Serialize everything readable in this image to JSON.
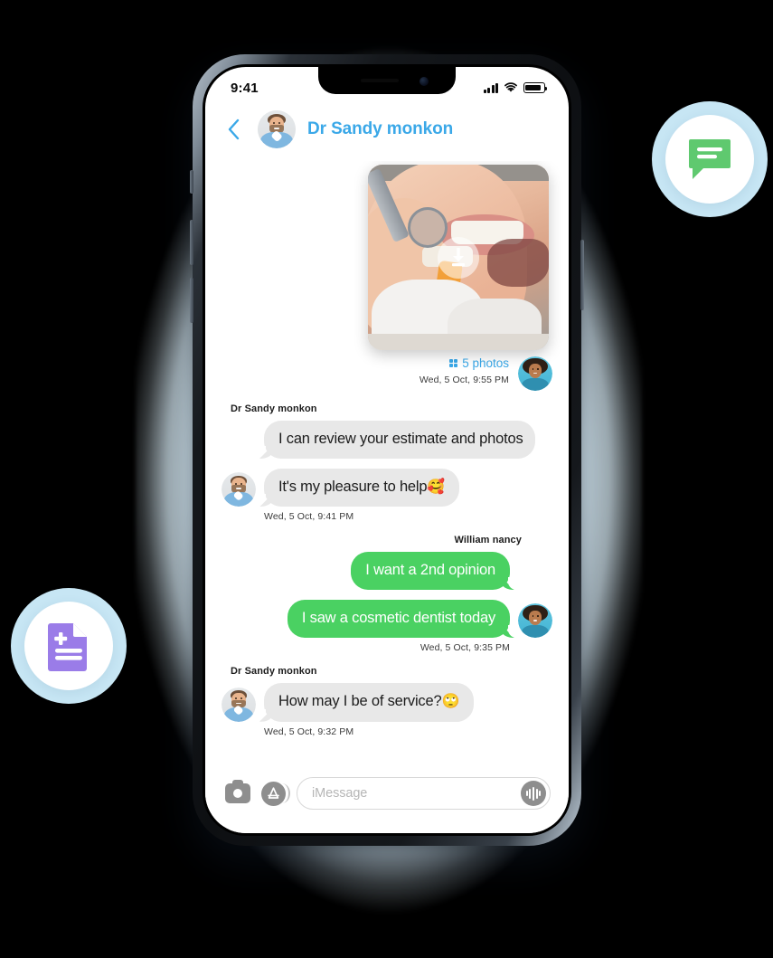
{
  "device": {
    "status_bar": {
      "time": "9:41",
      "signal_icon": "cellular-signal-icon",
      "wifi_icon": "wifi-icon",
      "battery_icon": "battery-icon"
    }
  },
  "header": {
    "back_icon": "back-chevron-icon",
    "avatar_name": "doctor-avatar",
    "title": "Dr Sandy monkon"
  },
  "conversation": {
    "photo_message": {
      "attachment_name": "dental-exam-photo",
      "download_icon": "download-icon",
      "photos_count_label": "5 photos",
      "grid_icon": "photo-grid-icon",
      "timestamp": "Wed, 5 Oct, 9:55 PM",
      "avatar_name": "patient-avatar"
    },
    "groups": [
      {
        "direction": "incoming",
        "sender": "Dr Sandy monkon",
        "messages": [
          {
            "text": "I can review your estimate and photos"
          },
          {
            "text": "It's my pleasure to help",
            "emoji": "🥰"
          }
        ],
        "timestamp": "Wed, 5 Oct, 9:41 PM",
        "avatar_name": "doctor-avatar"
      },
      {
        "direction": "outgoing",
        "sender": "William nancy",
        "messages": [
          {
            "text": "I want a 2nd opinion"
          },
          {
            "text": "I saw a cosmetic dentist today"
          }
        ],
        "timestamp": "Wed, 5 Oct, 9:35 PM",
        "avatar_name": "patient-avatar"
      },
      {
        "direction": "incoming",
        "sender": "Dr Sandy monkon",
        "messages": [
          {
            "text": "How may I be of service?",
            "emoji": "🙄"
          }
        ],
        "timestamp": "Wed, 5 Oct, 9:32 PM",
        "avatar_name": "doctor-avatar"
      }
    ]
  },
  "input_bar": {
    "camera_icon": "camera-icon",
    "appstore_icon": "app-store-icon",
    "placeholder": "iMessage",
    "value": "",
    "audio_icon": "audio-waveform-icon"
  },
  "badges": [
    {
      "name": "chat-bubble-badge",
      "icon": "chat-bubble-icon",
      "color": "#5fc96f",
      "ring": "#c7e6f4"
    },
    {
      "name": "medical-document-badge",
      "icon": "document-plus-icon",
      "color": "#9a7ce8",
      "ring": "#c7e6f4"
    }
  ],
  "colors": {
    "accent_blue": "#3aa8e8",
    "bubble_green": "#4ad162",
    "bubble_gray": "#e8e8e8",
    "glow_blue": "#d6e7ef"
  }
}
